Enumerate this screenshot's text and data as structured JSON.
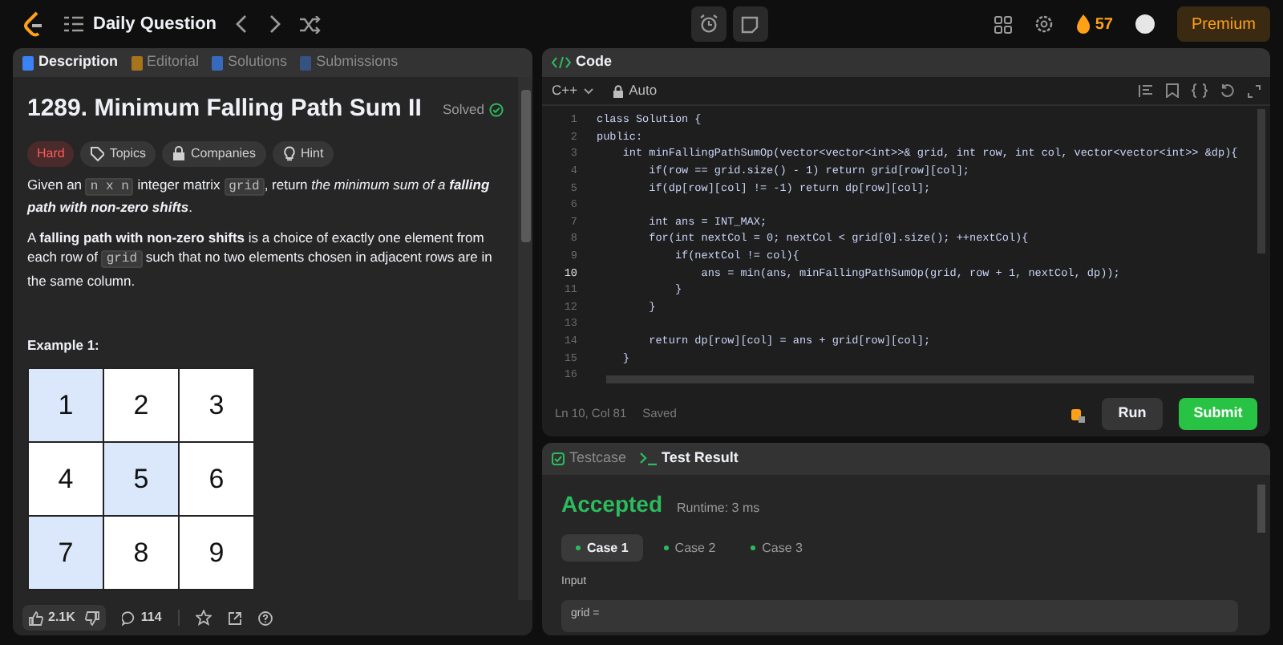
{
  "top_bar": {
    "title": "Daily Question",
    "streak": "57",
    "premium": "Premium"
  },
  "description_panel": {
    "tabs": [
      {
        "label": "Description",
        "selected": true
      },
      {
        "label": "Editorial",
        "selected": false
      },
      {
        "label": "Solutions",
        "selected": false
      },
      {
        "label": "Submissions",
        "selected": false
      }
    ],
    "title": "1289. Minimum Falling Path Sum II",
    "status": "Solved",
    "tags": [
      {
        "label": "Hard",
        "kind": "difficulty"
      },
      {
        "label": "Topics",
        "kind": "topics"
      },
      {
        "label": "Companies",
        "kind": "companies"
      },
      {
        "label": "Hint",
        "kind": "hint"
      }
    ],
    "paragraphs": [
      [
        {
          "kind": "text",
          "text": "Given an "
        },
        {
          "kind": "code",
          "text": "n x n"
        },
        {
          "kind": "text",
          "text": " integer matrix "
        },
        {
          "kind": "code",
          "text": "grid"
        },
        {
          "kind": "text",
          "text": ", return *the minimum sum of a* "
        },
        {
          "kind": "emphasis",
          "text": "falling path with non-zero shifts"
        },
        {
          "kind": "text",
          "text": "."
        }
      ],
      [
        {
          "kind": "text",
          "text": "A **falling path with non-zero shifts** is a choice of exactly one element from each row of "
        },
        {
          "kind": "code",
          "text": "grid"
        },
        {
          "kind": "text",
          "text": " such that no two elements chosen in adjacent rows are in the same column."
        }
      ]
    ],
    "example_title": "Example 1:",
    "example_grid": [
      [
        {
          "value": "1",
          "selected": true
        },
        {
          "value": "2",
          "selected": false
        },
        {
          "value": "3",
          "selected": false
        }
      ],
      [
        {
          "value": "4",
          "selected": false
        },
        {
          "value": "5",
          "selected": true
        },
        {
          "value": "6",
          "selected": false
        }
      ],
      [
        {
          "value": "7",
          "selected": true
        },
        {
          "value": "8",
          "selected": false
        },
        {
          "value": "9",
          "selected": false
        }
      ]
    ],
    "likes": "2.1K",
    "comments": "114"
  },
  "code_panel": {
    "title": "Code",
    "language": "C++",
    "mode": "Auto",
    "lines": [
      {
        "number": "1",
        "text": "class Solution {"
      },
      {
        "number": "2",
        "text": "public:"
      },
      {
        "number": "3",
        "text": "    int minFallingPathSumOp(vector<vector<int>>& grid, int row, int col, vector<vector<int>> &dp){"
      },
      {
        "number": "4",
        "text": "        if(row == grid.size() - 1) return grid[row][col];"
      },
      {
        "number": "5",
        "text": "        if(dp[row][col] != -1) return dp[row][col];"
      },
      {
        "number": "6"
      },
      {
        "number": "7",
        "text": "        int ans = INT_MAX;"
      },
      {
        "number": "8",
        "text": "        for(int nextCol = 0; nextCol < grid[0].size(); ++nextCol){"
      },
      {
        "number": "9",
        "text": "            if(nextCol != col){"
      },
      {
        "number": "10",
        "text": "                ans = min(ans, minFallingPathSumOp(grid, row + 1, nextCol, dp));"
      },
      {
        "number": "11",
        "text": "            }"
      },
      {
        "number": "12",
        "text": "        }"
      },
      {
        "number": "13"
      },
      {
        "number": "14",
        "text": "        return dp[row][col] = ans + grid[row][col];"
      },
      {
        "number": "15",
        "text": "    }"
      },
      {
        "number": "16"
      }
    ],
    "cursor": "Ln 10, Col 81",
    "save_state": "Saved",
    "run": "Run",
    "submit": "Submit"
  },
  "result_panel": {
    "tabs": [
      {
        "label": "Testcase",
        "selected": false
      },
      {
        "label": "Test Result",
        "selected": true
      }
    ],
    "verdict": "Accepted",
    "runtime": "Runtime: 3 ms",
    "cases": [
      {
        "label": "Case 1",
        "selected": true
      },
      {
        "label": "Case 2",
        "selected": false
      },
      {
        "label": "Case 3",
        "selected": false
      }
    ],
    "input_label": "Input",
    "input_value": "grid ="
  }
}
